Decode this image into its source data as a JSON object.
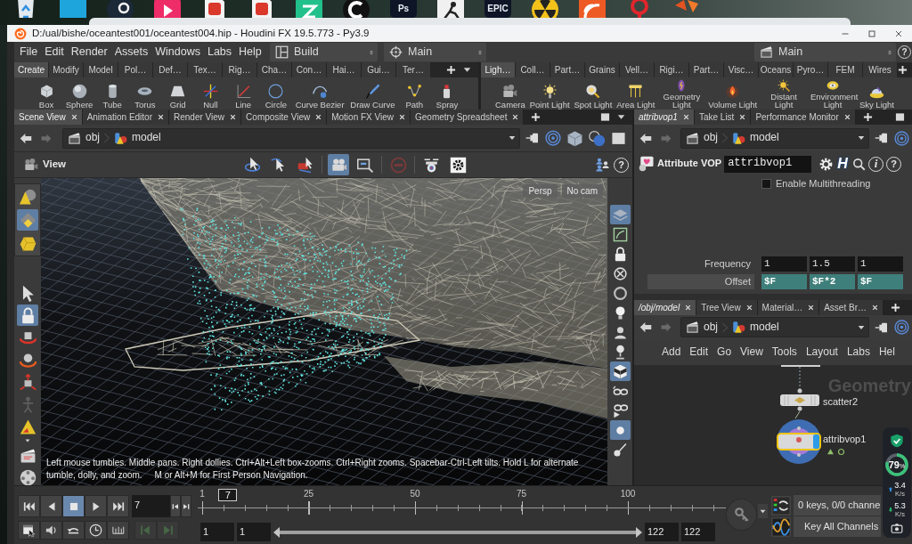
{
  "desktop": {
    "icons": [
      {
        "kind": "bin"
      },
      {
        "kind": "square"
      },
      {
        "kind": "round"
      },
      {
        "kind": "play"
      },
      {
        "kind": "doc"
      },
      {
        "kind": "doc"
      },
      {
        "kind": "arrow"
      },
      {
        "kind": "ring"
      },
      {
        "kind": "text",
        "text": "Ps"
      },
      {
        "kind": "figure"
      },
      {
        "kind": "text",
        "text": "EPIC"
      },
      {
        "kind": "hazard"
      },
      {
        "kind": "feed"
      },
      {
        "kind": "pin"
      },
      {
        "kind": "shapes"
      }
    ]
  },
  "window": {
    "title": "D:/ual/bishe/oceantest001/oceantest004.hip - Houdini FX 19.5.773 - Py3.9"
  },
  "menu_bar": {
    "items": [
      "File",
      "Edit",
      "Render",
      "Assets",
      "Windows",
      "Labs",
      "Help"
    ],
    "desktop": "Build",
    "view": "Main",
    "main": "Main",
    "help": "?"
  },
  "shelves": [
    {
      "tabs": [
        {
          "label": "Create",
          "selected": true
        },
        {
          "label": "Modify",
          "selected": false
        },
        {
          "label": "Model",
          "selected": false
        },
        {
          "label": "Pol…",
          "selected": false
        },
        {
          "label": "Def…",
          "selected": false
        },
        {
          "label": "Tex…",
          "selected": false
        },
        {
          "label": "Rig…",
          "selected": false
        },
        {
          "label": "Cha…",
          "selected": false
        },
        {
          "label": "Con…",
          "selected": false
        },
        {
          "label": "Hai…",
          "selected": false
        },
        {
          "label": "Gui…",
          "selected": false
        },
        {
          "label": "Ter…",
          "selected": false
        }
      ],
      "tools": [
        {
          "label": "Box",
          "kind": "box"
        },
        {
          "label": "Sphere",
          "kind": "sphere"
        },
        {
          "label": "Tube",
          "kind": "tube"
        },
        {
          "label": "Torus",
          "kind": "torus"
        },
        {
          "label": "Grid",
          "kind": "grid"
        },
        {
          "label": "Null",
          "kind": "null"
        },
        {
          "label": "Line",
          "kind": "line"
        },
        {
          "label": "Circle",
          "kind": "circle"
        },
        {
          "label": "Curve Bezier",
          "kind": "bezier"
        },
        {
          "label": "Draw Curve",
          "kind": "pen"
        },
        {
          "label": "Path",
          "kind": "path"
        },
        {
          "label": "Spray",
          "kind": "spray"
        }
      ]
    },
    {
      "tabs": [
        {
          "label": "Ligh…",
          "selected": true
        },
        {
          "label": "Coll…",
          "selected": false
        },
        {
          "label": "Part…",
          "selected": false
        },
        {
          "label": "Grains",
          "selected": false
        },
        {
          "label": "Vell…",
          "selected": false
        },
        {
          "label": "Rigi…",
          "selected": false
        },
        {
          "label": "Part…",
          "selected": false
        },
        {
          "label": "Visc…",
          "selected": false
        },
        {
          "label": "Oceans",
          "selected": false
        },
        {
          "label": "Pyro…",
          "selected": false
        },
        {
          "label": "FEM",
          "selected": false
        },
        {
          "label": "Wires",
          "selected": false
        }
      ],
      "tools": [
        {
          "label": "Camera",
          "kind": "camera"
        },
        {
          "label": "Point Light",
          "kind": "pointlight"
        },
        {
          "label": "Spot Light",
          "kind": "spotlight"
        },
        {
          "label": "Area Light",
          "kind": "arealight"
        },
        {
          "label": "Geometry Light",
          "kind": "geolight"
        },
        {
          "label": "Volume Light",
          "kind": "volumelight"
        },
        {
          "label": "Distant Light",
          "kind": "distantlight"
        },
        {
          "label": "Environment Light",
          "kind": "envlight"
        },
        {
          "label": "Sky Light",
          "kind": "skylight"
        }
      ]
    }
  ],
  "scene_view": {
    "tabs": [
      {
        "label": "Scene View",
        "selected": true
      },
      {
        "label": "Animation Editor",
        "selected": false
      },
      {
        "label": "Render View",
        "selected": false
      },
      {
        "label": "Composite View",
        "selected": false
      },
      {
        "label": "Motion FX View",
        "selected": false
      },
      {
        "label": "Geometry Spreadsheet",
        "selected": false
      }
    ],
    "path": [
      "obj",
      "model"
    ],
    "title": "View",
    "tools": [
      {
        "kind": "orbit",
        "selected": false,
        "disabled": false
      },
      {
        "kind": "select-arrow",
        "selected": false,
        "disabled": false
      },
      {
        "kind": "select-camera",
        "selected": false,
        "disabled": false
      },
      {
        "kind": "camera-group",
        "selected": true,
        "disabled": false
      },
      {
        "kind": "zoom-frame",
        "selected": false,
        "disabled": false
      },
      {
        "kind": "no-entry",
        "selected": false,
        "disabled": true
      },
      {
        "kind": "drone",
        "selected": false,
        "disabled": false
      },
      {
        "kind": "gear-tile",
        "selected": false,
        "disabled": false
      }
    ],
    "help": "?",
    "left_tools": [
      {
        "kind": "cone-sphere",
        "selected": false,
        "disabled": false
      },
      {
        "kind": "diamond",
        "selected": true,
        "disabled": false
      },
      {
        "kind": "polygon",
        "selected": false,
        "disabled": false
      },
      {
        "kind": "arrow",
        "selected": false,
        "disabled": false
      },
      {
        "kind": "lock",
        "selected": true,
        "disabled": false
      },
      {
        "kind": "cube-rotate",
        "selected": false,
        "disabled": false
      },
      {
        "kind": "sphere-rotate",
        "selected": false,
        "disabled": false
      },
      {
        "kind": "cube-move",
        "selected": false,
        "disabled": false
      },
      {
        "kind": "figure",
        "selected": false,
        "disabled": true
      },
      {
        "kind": "triangle",
        "selected": false,
        "disabled": false
      },
      {
        "kind": "clapboard",
        "selected": false,
        "disabled": false
      },
      {
        "kind": "reel",
        "selected": false,
        "disabled": false
      }
    ],
    "right_tools": [
      {
        "kind": "layers",
        "selected": true
      },
      {
        "kind": "framed-curve",
        "selected": false
      },
      {
        "kind": "lock",
        "selected": false
      },
      {
        "kind": "circle-cross",
        "selected": false
      },
      {
        "kind": "ring",
        "selected": false
      },
      {
        "kind": "bulb",
        "selected": false
      },
      {
        "kind": "bust",
        "selected": false
      },
      {
        "kind": "lamp",
        "selected": false
      },
      {
        "kind": "checker-cube",
        "selected": true
      },
      {
        "kind": "glasses",
        "selected": false
      },
      {
        "kind": "glasses-play",
        "selected": false
      },
      {
        "kind": "dot",
        "selected": true
      },
      {
        "kind": "brush",
        "selected": false
      }
    ],
    "camera_menus": [
      "Persp",
      "No cam"
    ],
    "hint": "Left mouse tumbles. Middle pans. Right dollies. Ctrl+Alt+Left box-zooms. Ctrl+Right zooms. Spacebar-Ctrl-Left tilts. Hold L for alternate tumble, dolly, and zoom.     M or Alt+M for First Person Navigation."
  },
  "parameters": {
    "tabs": [
      {
        "label": "attribvop1",
        "selected": true,
        "follows_selection": true
      },
      {
        "label": "Take List",
        "selected": false,
        "follows_selection": false
      },
      {
        "label": "Performance Monitor",
        "selected": false,
        "follows_selection": false
      }
    ],
    "path": [
      "obj",
      "model"
    ],
    "node_type": "Attribute VOP",
    "node_name": "attribvop1",
    "manual": "H",
    "info": "i",
    "help": "?",
    "toggle": {
      "label": "Enable Multithreading",
      "checked": false
    },
    "rows": [
      {
        "label": "Frequency",
        "kind": "value",
        "values": [
          "1",
          "1.5",
          "1"
        ]
      },
      {
        "label": "Offset",
        "kind": "expression",
        "values": [
          "$F",
          "$F*2",
          "$F"
        ]
      }
    ]
  },
  "network": {
    "tabs": [
      {
        "label": "/obj/model",
        "selected": true,
        "follows_selection": true
      },
      {
        "label": "Tree View",
        "selected": false,
        "follows_selection": false
      },
      {
        "label": "Material…",
        "selected": false,
        "follows_selection": false
      },
      {
        "label": "Asset Br…",
        "selected": false,
        "follows_selection": false
      }
    ],
    "path": [
      "obj",
      "model"
    ],
    "menu": [
      "Add",
      "Edit",
      "Go",
      "View",
      "Tools",
      "Layout",
      "Labs",
      "Hel"
    ],
    "context": "Geometry",
    "nodes": [
      {
        "name": "scatter2",
        "kind": "sop",
        "selected": false,
        "display": false
      },
      {
        "name": "attribvop1",
        "kind": "vop",
        "selected": true,
        "display": true
      }
    ]
  },
  "timeline": {
    "transport": [
      {
        "kind": "first",
        "selected": false
      },
      {
        "kind": "back",
        "selected": false
      },
      {
        "kind": "stop",
        "selected": true
      },
      {
        "kind": "play",
        "selected": false
      },
      {
        "kind": "last",
        "selected": false
      }
    ],
    "frame": "7",
    "ruler_labels": [
      "1",
      "25",
      "50",
      "75",
      "100"
    ],
    "playhead": {
      "label": "7",
      "level": 0.05
    },
    "tools": [
      {
        "kind": "flipbook",
        "disabled": false
      },
      {
        "kind": "audio",
        "disabled": false
      },
      {
        "kind": "undo",
        "disabled": false
      },
      {
        "kind": "clock",
        "disabled": false
      },
      {
        "kind": "ruler",
        "disabled": false
      },
      {
        "kind": "prev-key",
        "disabled": true
      },
      {
        "kind": "next-key",
        "disabled": true
      }
    ],
    "range": [
      "1",
      "1",
      "122",
      "122"
    ],
    "range_bar": {
      "level": 1
    },
    "keys_status": "0 keys, 0/0 channe",
    "key_all": "Key All Channels"
  },
  "net_monitor": {
    "level": 0.79,
    "percent": "79",
    "percent_sign": "%",
    "upload": "3.4",
    "upload_unit": "K/s",
    "download": "5.3",
    "download_unit": "K/s"
  }
}
